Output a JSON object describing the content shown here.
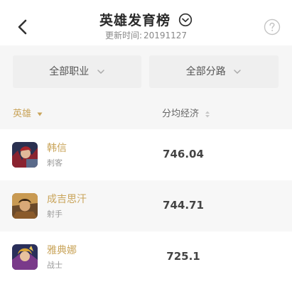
{
  "header": {
    "title": "英雄发育榜",
    "updated_label": "更新时间:",
    "updated_value": "20191127"
  },
  "filters": {
    "profession": "全部职业",
    "lane": "全部分路"
  },
  "columns": {
    "hero": "英雄",
    "economy": "分均经济"
  },
  "colors": {
    "accent": "#c9a45a"
  },
  "heroes": [
    {
      "name": "韩信",
      "role": "刺客",
      "value": "746.04"
    },
    {
      "name": "成吉思汗",
      "role": "射手",
      "value": "744.71"
    },
    {
      "name": "雅典娜",
      "role": "战士",
      "value": "725.1"
    }
  ]
}
